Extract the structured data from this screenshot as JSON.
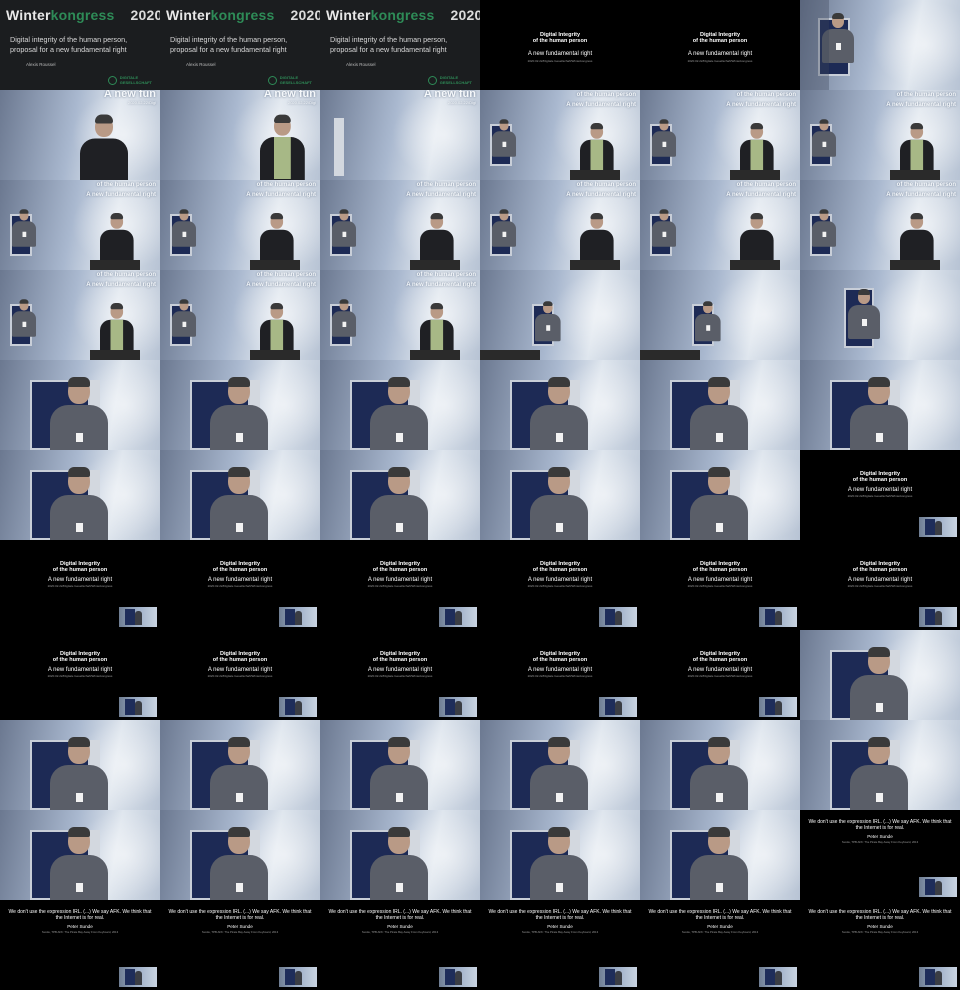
{
  "title_card": {
    "brand_main": "Winter",
    "brand_accent": "kongress",
    "year": "2020",
    "subtitle_line1": "Digital integrity of the human person,",
    "subtitle_line2": "proposal for a new fundamental right",
    "author": "Alexis Roussel",
    "logo_line1": "DIGITALE",
    "logo_line2": "GESELLSCHAFT",
    "accent_color": "#2e8b57"
  },
  "slide_integrity": {
    "title_line1": "Digital Integrity",
    "title_line2": "of the human person",
    "subtitle": "A new fundamental right",
    "footer": "2020.02.22/Digitale Gesellschaft/Winterkongress"
  },
  "screen_text": {
    "big": "A new fun",
    "date": "2020.02.22/Digi",
    "human": "of the human person",
    "right": "A new fundamental right"
  },
  "quote_slide": {
    "quote": "We don't use the expression IRL. (...) We say AFK. We think that the Internet is for real.",
    "attribution": "Peter Sunde",
    "source": "Sunde, TPB AFK: The Pirate Bay Away From Keyboard, 2013"
  },
  "tiles": [
    "title",
    "title",
    "title",
    "integrity-full",
    "integrity-full",
    "photo-a",
    "photo-b",
    "photo-c",
    "photo-d",
    "photo-e",
    "photo-e",
    "photo-e",
    "photo-f",
    "photo-f",
    "photo-f",
    "photo-f",
    "photo-f",
    "photo-f",
    "photo-g",
    "photo-g",
    "photo-g",
    "photo-h",
    "photo-h",
    "photo-i",
    "close",
    "close",
    "close",
    "close",
    "close",
    "close",
    "close",
    "close",
    "close",
    "close",
    "close",
    "slide-pip",
    "slide-pip",
    "slide-pip",
    "slide-pip",
    "slide-pip",
    "slide-pip",
    "slide-pip",
    "slide-pip",
    "slide-pip",
    "slide-pip",
    "slide-pip",
    "slide-pip",
    "close",
    "close",
    "close",
    "close",
    "close",
    "close",
    "close",
    "close",
    "close",
    "close",
    "close",
    "close",
    "quote-pip",
    "quote-pip",
    "quote-pip",
    "quote-pip",
    "quote-pip",
    "quote-pip",
    "quote-pip"
  ]
}
